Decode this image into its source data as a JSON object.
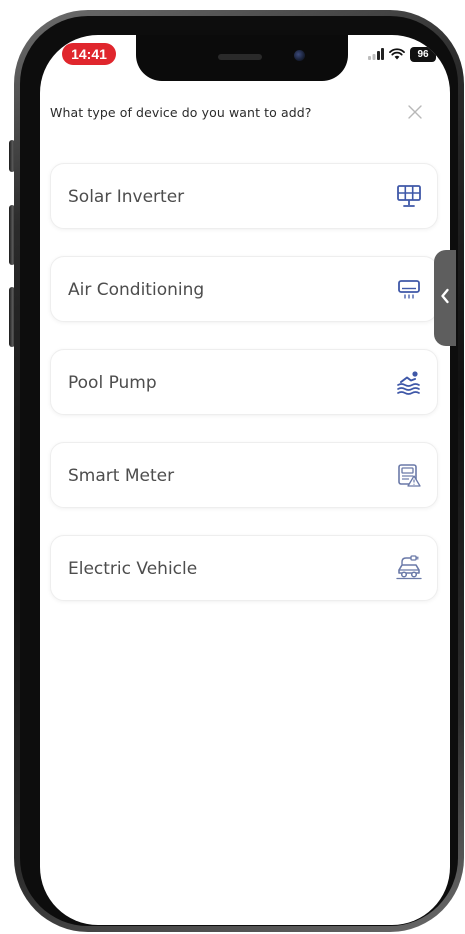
{
  "status_bar": {
    "time": "14:41",
    "battery": "96"
  },
  "modal": {
    "title": "What type of device do you want to add?",
    "close_icon": "close-icon"
  },
  "devices": [
    {
      "label": "Solar Inverter",
      "icon": "solar-panel-icon"
    },
    {
      "label": "Air Conditioning",
      "icon": "air-conditioner-icon"
    },
    {
      "label": "Pool Pump",
      "icon": "pool-swimmer-icon"
    },
    {
      "label": "Smart Meter",
      "icon": "smart-meter-icon"
    },
    {
      "label": "Electric Vehicle",
      "icon": "electric-vehicle-icon"
    }
  ],
  "side_tab": {
    "icon": "chevron-left-icon"
  },
  "colors": {
    "time_pill": "#e0262d",
    "icon_accent": "#3f58a8",
    "side_tab": "#5e5e5e"
  }
}
